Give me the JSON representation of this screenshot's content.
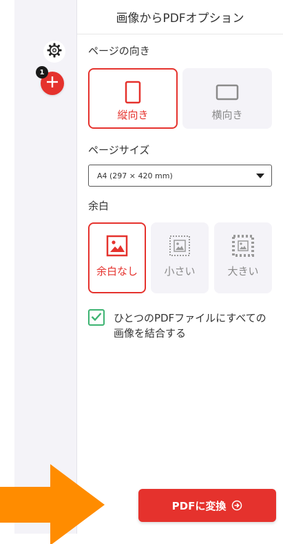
{
  "panel": {
    "title": "画像からPDFオプション"
  },
  "sidebar": {
    "file_count": "1"
  },
  "orientation": {
    "label": "ページの向き",
    "options": [
      {
        "label": "縦向き",
        "selected": true
      },
      {
        "label": "横向き",
        "selected": false
      }
    ]
  },
  "page_size": {
    "label": "ページサイズ",
    "value": "A4 (297 × 420 mm)"
  },
  "margin": {
    "label": "余白",
    "options": [
      {
        "label": "余白なし",
        "selected": true
      },
      {
        "label": "小さい",
        "selected": false
      },
      {
        "label": "大きい",
        "selected": false
      }
    ]
  },
  "merge": {
    "checked": true,
    "label": "ひとつのPDFファイルにすべての画像を結合する"
  },
  "convert_button": {
    "label": "PDFに変換"
  },
  "colors": {
    "accent": "#e5322d",
    "check": "#3cb371",
    "pointer_arrow": "#ff8c00"
  }
}
